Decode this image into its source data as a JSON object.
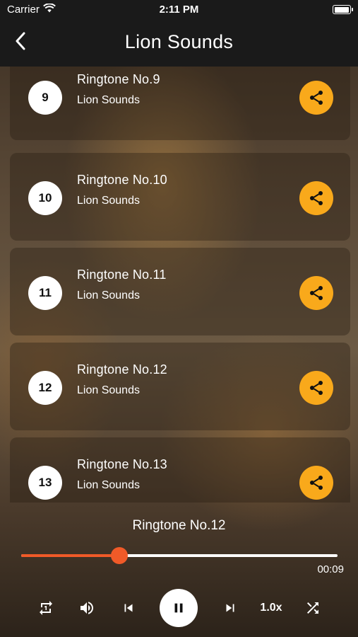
{
  "status": {
    "carrier": "Carrier",
    "time": "2:11 PM"
  },
  "header": {
    "title": "Lion Sounds"
  },
  "ringtones": [
    {
      "number": "9",
      "name": "Ringtone No.9",
      "subtitle": "Lion Sounds"
    },
    {
      "number": "10",
      "name": "Ringtone No.10",
      "subtitle": "Lion Sounds"
    },
    {
      "number": "11",
      "name": "Ringtone No.11",
      "subtitle": "Lion Sounds"
    },
    {
      "number": "12",
      "name": "Ringtone No.12",
      "subtitle": "Lion Sounds"
    },
    {
      "number": "13",
      "name": "Ringtone No.13",
      "subtitle": "Lion Sounds"
    }
  ],
  "player": {
    "now_playing": "Ringtone No.12",
    "elapsed": "00:09",
    "progress_fraction": 0.31,
    "speed": "1.0x"
  },
  "colors": {
    "accent": "#f05a28",
    "share": "#f9a91b",
    "bars": "#1a1a1a"
  },
  "icons": {
    "back": "chevron-left-icon",
    "share": "share-icon",
    "repeat": "repeat-one-icon",
    "volume": "volume-icon",
    "previous": "skip-previous-icon",
    "pause": "pause-icon",
    "next": "skip-next-icon",
    "shuffle": "shuffle-icon",
    "wifi": "wifi-icon",
    "battery": "battery-icon"
  }
}
